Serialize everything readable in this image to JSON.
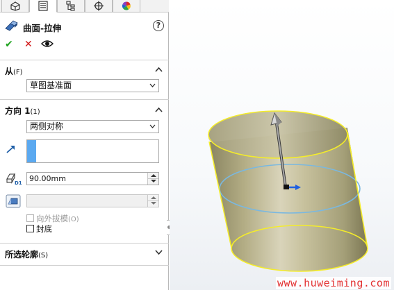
{
  "feature": {
    "title": "曲面-拉伸",
    "help": "?",
    "icon": "extrude-surface-icon"
  },
  "tabs": [
    {
      "icon": "feature-manager-icon",
      "active": false
    },
    {
      "icon": "property-manager-icon",
      "active": true
    },
    {
      "icon": "configuration-manager-icon",
      "active": false
    },
    {
      "icon": "dim-xpert-icon",
      "active": false
    },
    {
      "icon": "display-manager-icon",
      "active": false
    }
  ],
  "actions": {
    "ok": "✔",
    "cancel": "✕",
    "preview": "eye-icon"
  },
  "from": {
    "label": "从",
    "shortcut": "(F)",
    "value": "草图基准面"
  },
  "direction1": {
    "label": "方向 1",
    "shortcut": "(1)",
    "end_condition": "两侧对称",
    "depth": "90.00mm",
    "draft": "",
    "draft_outward_label": "向外拔模",
    "draft_outward_shortcut": "(O)",
    "cap_end_label": "封底",
    "depth_tag": "D1"
  },
  "selected_contours": {
    "label": "所选轮廓",
    "shortcut": "(S)"
  },
  "watermark": "www.huweiming.com",
  "colors": {
    "body": "#b9b38e",
    "edge": "#f4ec2a",
    "sketch": "#7ab8e0",
    "ok": "#1fa31f",
    "cancel": "#d01616"
  }
}
